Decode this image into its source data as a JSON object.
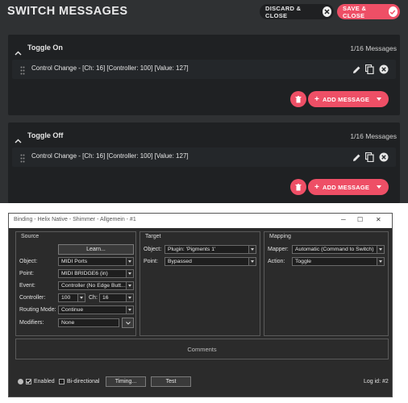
{
  "top": {
    "title": "SWITCH MESSAGES",
    "discard_label": "DISCARD & CLOSE",
    "save_label": "SAVE & CLOSE",
    "accent_color": "#ee4f66",
    "panels": [
      {
        "title": "Toggle On",
        "count": "1/16 Messages",
        "message": "Control Change - [Ch: 16] [Controller: 100] [Value: 127]",
        "add_label": "ADD MESSAGE"
      },
      {
        "title": "Toggle Off",
        "count": "1/16 Messages",
        "message": "Control Change - [Ch: 16] [Controller: 100] [Value: 127]",
        "add_label": "ADD MESSAGE"
      }
    ]
  },
  "dialog": {
    "title": "Binding - Helix Native - Shimmer - Allgemein - #1",
    "source": {
      "title": "Source",
      "learn_label": "Learn...",
      "object_label": "Object:",
      "object_value": "MIDI Ports",
      "point_label": "Point:",
      "point_value": "MIDI BRIDGE6 (in)",
      "event_label": "Event:",
      "event_value": "Controller (No Edge Butt...",
      "controller_label": "Controller:",
      "controller_value": "100",
      "ch_label": "Ch:",
      "ch_value": "16",
      "routing_label": "Routing Mode:",
      "routing_value": "Continue",
      "modifiers_label": "Modifiers:",
      "modifiers_value": "None"
    },
    "target": {
      "title": "Target",
      "object_label": "Object:",
      "object_value": "Plugin: 'Pigments 1'",
      "point_label": "Point:",
      "point_value": "Bypassed"
    },
    "mapping": {
      "title": "Mapping",
      "mapper_label": "Mapper:",
      "mapper_value": "Automatic (Command to Switch)",
      "action_label": "Action:",
      "action_value": "Toggle"
    },
    "comments_label": "Comments",
    "enabled_label": "Enabled",
    "bidirectional_label": "Bi-directional",
    "timing_label": "Timing...",
    "test_label": "Test",
    "log_label": "Log id: #2"
  }
}
